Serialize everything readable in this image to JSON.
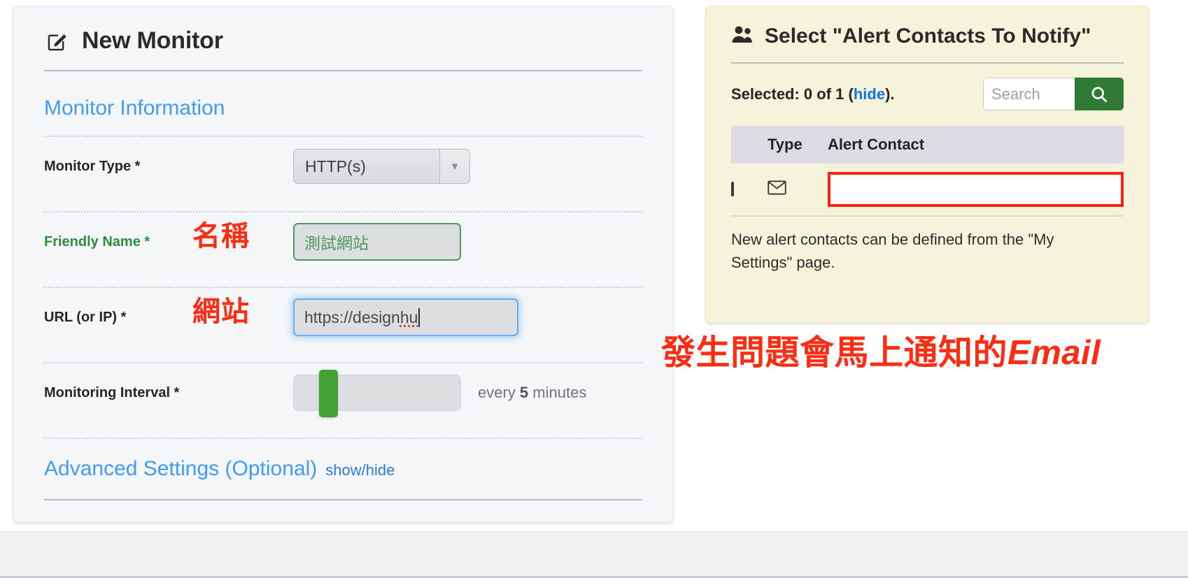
{
  "monitor_card": {
    "header": {
      "icon": "edit-pencil-icon",
      "title": "New Monitor"
    },
    "section_title": "Monitor Information",
    "fields": {
      "monitor_type": {
        "label": "Monitor Type *",
        "value": "HTTP(s)",
        "dropdown_icon": "chevron-down-icon"
      },
      "friendly_name": {
        "label": "Friendly Name *",
        "value": "測試網站",
        "annotation": "名稱"
      },
      "url": {
        "label": "URL (or IP) *",
        "value_prefix": "https://design ",
        "value_misspelled": "hu",
        "annotation": "網站"
      },
      "monitoring_interval": {
        "label": "Monitoring Interval *",
        "caption_prefix": "every ",
        "caption_value": "5",
        "caption_suffix": " minutes",
        "slider_position_percent": 15
      }
    },
    "advanced": {
      "label": "Advanced Settings (Optional)",
      "toggle": "show/hide"
    }
  },
  "alert_contacts_card": {
    "header": {
      "icon": "users-group-icon",
      "title": "Select \"Alert Contacts To Notify\""
    },
    "selected_prefix": "Selected: 0 of 1 (",
    "selected_link": "hide",
    "selected_suffix": ").",
    "search": {
      "placeholder": "Search",
      "value": "",
      "button_icon": "search-icon"
    },
    "table": {
      "headers": {
        "check": "",
        "type": "Type",
        "contact": "Alert Contact"
      },
      "rows": [
        {
          "checked": false,
          "type_icon": "envelope-icon",
          "contact": "",
          "redacted": true
        }
      ]
    },
    "note": "New alert contacts can be defined from the \"My Settings\" page."
  },
  "annotations": {
    "email_note_cjk": "發生問題會馬上通知的",
    "email_note_latin": "Email"
  },
  "colors": {
    "accent_blue": "#3f9bf4",
    "annotation_red": "#fb2d12",
    "green_valid": "#4e9a5a",
    "slider_green": "#43a234",
    "search_green": "#2f7a34",
    "card_yellow": "#f5f3da"
  }
}
